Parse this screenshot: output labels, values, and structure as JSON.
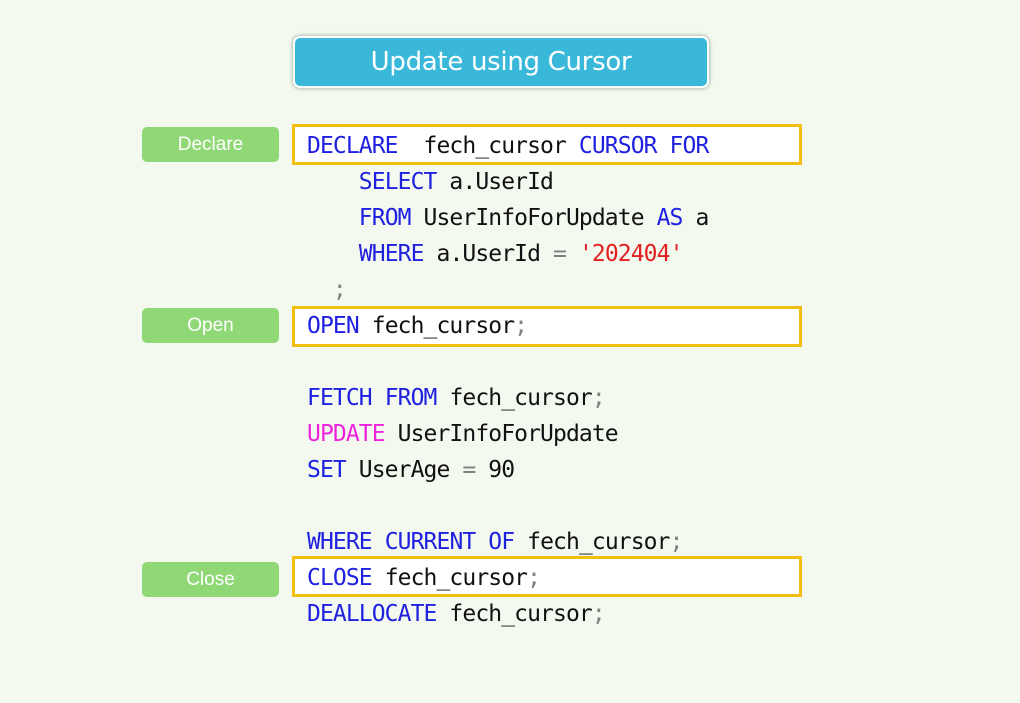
{
  "title": "Update using Cursor",
  "labels": {
    "declare": "Declare",
    "open": "Open",
    "close": "Close"
  },
  "code_lines": [
    {
      "indent": "",
      "tokens": [
        {
          "t": "kw",
          "v": "DECLARE"
        },
        {
          "t": "tx",
          "v": "  fech_cursor "
        },
        {
          "t": "kw",
          "v": "CURSOR"
        },
        {
          "t": "tx",
          "v": " "
        },
        {
          "t": "kw",
          "v": "FOR"
        }
      ],
      "highlight": true
    },
    {
      "indent": "    ",
      "tokens": [
        {
          "t": "kw",
          "v": "SELECT"
        },
        {
          "t": "tx",
          "v": " a.UserId"
        }
      ]
    },
    {
      "indent": "    ",
      "tokens": [
        {
          "t": "kw",
          "v": "FROM"
        },
        {
          "t": "tx",
          "v": " UserInfoForUpdate "
        },
        {
          "t": "kw",
          "v": "AS"
        },
        {
          "t": "tx",
          "v": " a"
        }
      ]
    },
    {
      "indent": "    ",
      "tokens": [
        {
          "t": "kw",
          "v": "WHERE"
        },
        {
          "t": "tx",
          "v": " a.UserId "
        },
        {
          "t": "op",
          "v": "="
        },
        {
          "t": "tx",
          "v": " "
        },
        {
          "t": "str",
          "v": "'202404'"
        }
      ]
    },
    {
      "indent": "  ",
      "tokens": [
        {
          "t": "op",
          "v": ";"
        }
      ]
    },
    {
      "indent": "",
      "tokens": [
        {
          "t": "kw",
          "v": "OPEN"
        },
        {
          "t": "tx",
          "v": " fech_cursor"
        },
        {
          "t": "op",
          "v": ";"
        }
      ],
      "highlight": true
    },
    {
      "indent": "",
      "tokens": []
    },
    {
      "indent": "",
      "tokens": [
        {
          "t": "kw",
          "v": "FETCH"
        },
        {
          "t": "tx",
          "v": " "
        },
        {
          "t": "kw",
          "v": "FROM"
        },
        {
          "t": "tx",
          "v": " fech_cursor"
        },
        {
          "t": "op",
          "v": ";"
        }
      ]
    },
    {
      "indent": "",
      "tokens": [
        {
          "t": "kw2",
          "v": "UPDATE"
        },
        {
          "t": "tx",
          "v": " UserInfoForUpdate"
        }
      ]
    },
    {
      "indent": "",
      "tokens": [
        {
          "t": "kw",
          "v": "SET"
        },
        {
          "t": "tx",
          "v": " UserAge "
        },
        {
          "t": "op",
          "v": "="
        },
        {
          "t": "tx",
          "v": " 90"
        }
      ]
    },
    {
      "indent": "",
      "tokens": []
    },
    {
      "indent": "",
      "tokens": [
        {
          "t": "kw",
          "v": "WHERE"
        },
        {
          "t": "tx",
          "v": " "
        },
        {
          "t": "kw",
          "v": "CURRENT"
        },
        {
          "t": "tx",
          "v": " "
        },
        {
          "t": "kw",
          "v": "OF"
        },
        {
          "t": "tx",
          "v": " fech_cursor"
        },
        {
          "t": "op",
          "v": ";"
        }
      ]
    },
    {
      "indent": "",
      "tokens": [
        {
          "t": "kw",
          "v": "CLOSE"
        },
        {
          "t": "tx",
          "v": " fech_cursor"
        },
        {
          "t": "op",
          "v": ";"
        }
      ],
      "highlight": true
    },
    {
      "indent": "",
      "tokens": [
        {
          "t": "kw",
          "v": "DEALLOCATE"
        },
        {
          "t": "tx",
          "v": " fech_cursor"
        },
        {
          "t": "op",
          "v": ";"
        }
      ]
    }
  ],
  "colors": {
    "background": "#f3f9ee",
    "title_bg": "#39b8da",
    "label_bg": "#90d876",
    "highlight_border": "#f2bf10",
    "keyword": "#2020e0",
    "update_keyword": "#ee22dd",
    "string": "#e02020"
  }
}
